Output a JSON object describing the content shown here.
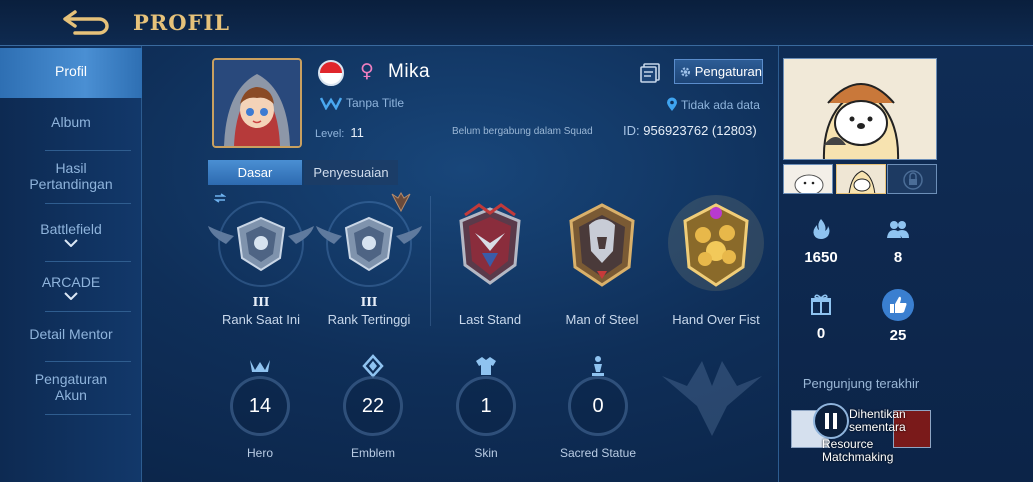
{
  "header": {
    "title": "PROFIL"
  },
  "sidebar": {
    "items": [
      {
        "label": "Profil"
      },
      {
        "label": "Album"
      },
      {
        "label": "Hasil Pertandingan"
      },
      {
        "label": "Battlefield"
      },
      {
        "label": "ARCADE"
      },
      {
        "label": "Detail Mentor"
      },
      {
        "label": "Pengaturan Akun"
      }
    ]
  },
  "profile": {
    "username": "Mika",
    "gender_symbol": "♀",
    "title": "Tanpa Title",
    "level_label": "Level:",
    "level_value": "11",
    "squad": "Belum bergabung dalam Squad",
    "settings_label": "Pengaturan",
    "location": "Tidak ada data",
    "id_label": "ID:",
    "id_value": "956923762 (12803)"
  },
  "tabs": [
    {
      "label": "Dasar",
      "active": true
    },
    {
      "label": "Penyesuaian",
      "active": false
    }
  ],
  "badges": [
    {
      "label": "Rank Saat Ini",
      "tier": "III"
    },
    {
      "label": "Rank Tertinggi",
      "tier": "III"
    },
    {
      "label": "Last Stand"
    },
    {
      "label": "Man of Steel"
    },
    {
      "label": "Hand Over Fist"
    }
  ],
  "stats": [
    {
      "label": "Hero",
      "value": "14"
    },
    {
      "label": "Emblem",
      "value": "22"
    },
    {
      "label": "Skin",
      "value": "1"
    },
    {
      "label": "Sacred Statue",
      "value": "0"
    }
  ],
  "right_stats": [
    {
      "icon": "flame-icon",
      "value": "1650"
    },
    {
      "icon": "friends-icon",
      "value": "8"
    },
    {
      "icon": "gift-icon",
      "value": "0"
    },
    {
      "icon": "thumbs-up-icon",
      "value": "25"
    }
  ],
  "visitors": {
    "title": "Pengunjung terakhir",
    "paused_line1": "Dihentikan",
    "paused_line2": "sementara",
    "resource_line1": "Resource",
    "resource_line2": "Matchmaking"
  },
  "colors": {
    "accent_gold": "#e6c27a",
    "active_tab": "#4a8fd3",
    "panel_bg": "#0f2f59"
  }
}
